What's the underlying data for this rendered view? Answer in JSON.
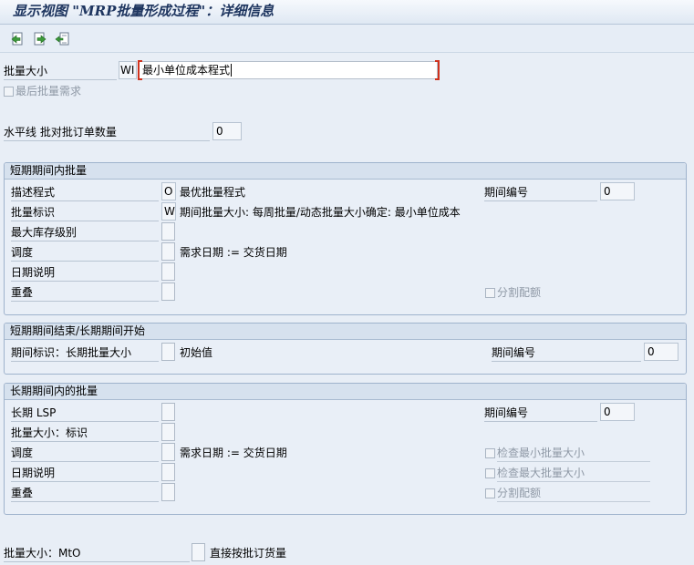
{
  "window": {
    "title": "显示视图 \"MRP批量形成过程\"：详细信息"
  },
  "toolbar": {
    "icons": [
      "previous-entry-icon",
      "next-entry-icon",
      "other-entry-icon"
    ]
  },
  "header": {
    "lot_size_label": "批量大小",
    "lot_size_code": "WI",
    "lot_size_text": "最小单位成本程式",
    "last_lot_label": "最后批量需求",
    "horizon_label": "水平线 批对批订单数量",
    "horizon_value": "0"
  },
  "short_term": {
    "title": "短期期间内批量",
    "proc_label": "描述程式",
    "proc_value": "O",
    "proc_text": "最优批量程式",
    "indicator_label": "批量标识",
    "indicator_value": "W",
    "indicator_text": "期间批量大小: 每周批量/动态批量大小确定: 最小单位成本",
    "max_stock_label": "最大库存级别",
    "scheduling_label": "调度",
    "scheduling_text": "需求日期 := 交货日期",
    "date_spec_label": "日期说明",
    "overlap_label": "重叠",
    "period_num_label": "期间编号",
    "period_num_value": "0",
    "split_quota_label": "分割配额"
  },
  "transition": {
    "title": "短期期间结束/长期期间开始",
    "period_indicator_label": "期间标识：长期批量大小",
    "initial_value_label": "初始值",
    "period_num_label": "期间编号",
    "period_num_value": "0"
  },
  "long_term": {
    "title": "长期期间内的批量",
    "lsp_label": "长期 LSP",
    "lot_ind_label": "批量大小：标识",
    "scheduling_label": "调度",
    "scheduling_text": "需求日期 := 交货日期",
    "date_spec_label": "日期说明",
    "overlap_label": "重叠",
    "period_num_label": "期间编号",
    "period_num_value": "0",
    "check_min_label": "检查最小批量大小",
    "check_max_label": "检查最大批量大小",
    "split_quota_label": "分割配额"
  },
  "footer": {
    "mto_label": "批量大小：MtO",
    "direct_label": "直接按批订货量"
  },
  "colors": {
    "title": "#1f3660",
    "background": "#e8eef6",
    "group_header": "#d6e1ee",
    "focus_bracket": "#d0321d"
  }
}
